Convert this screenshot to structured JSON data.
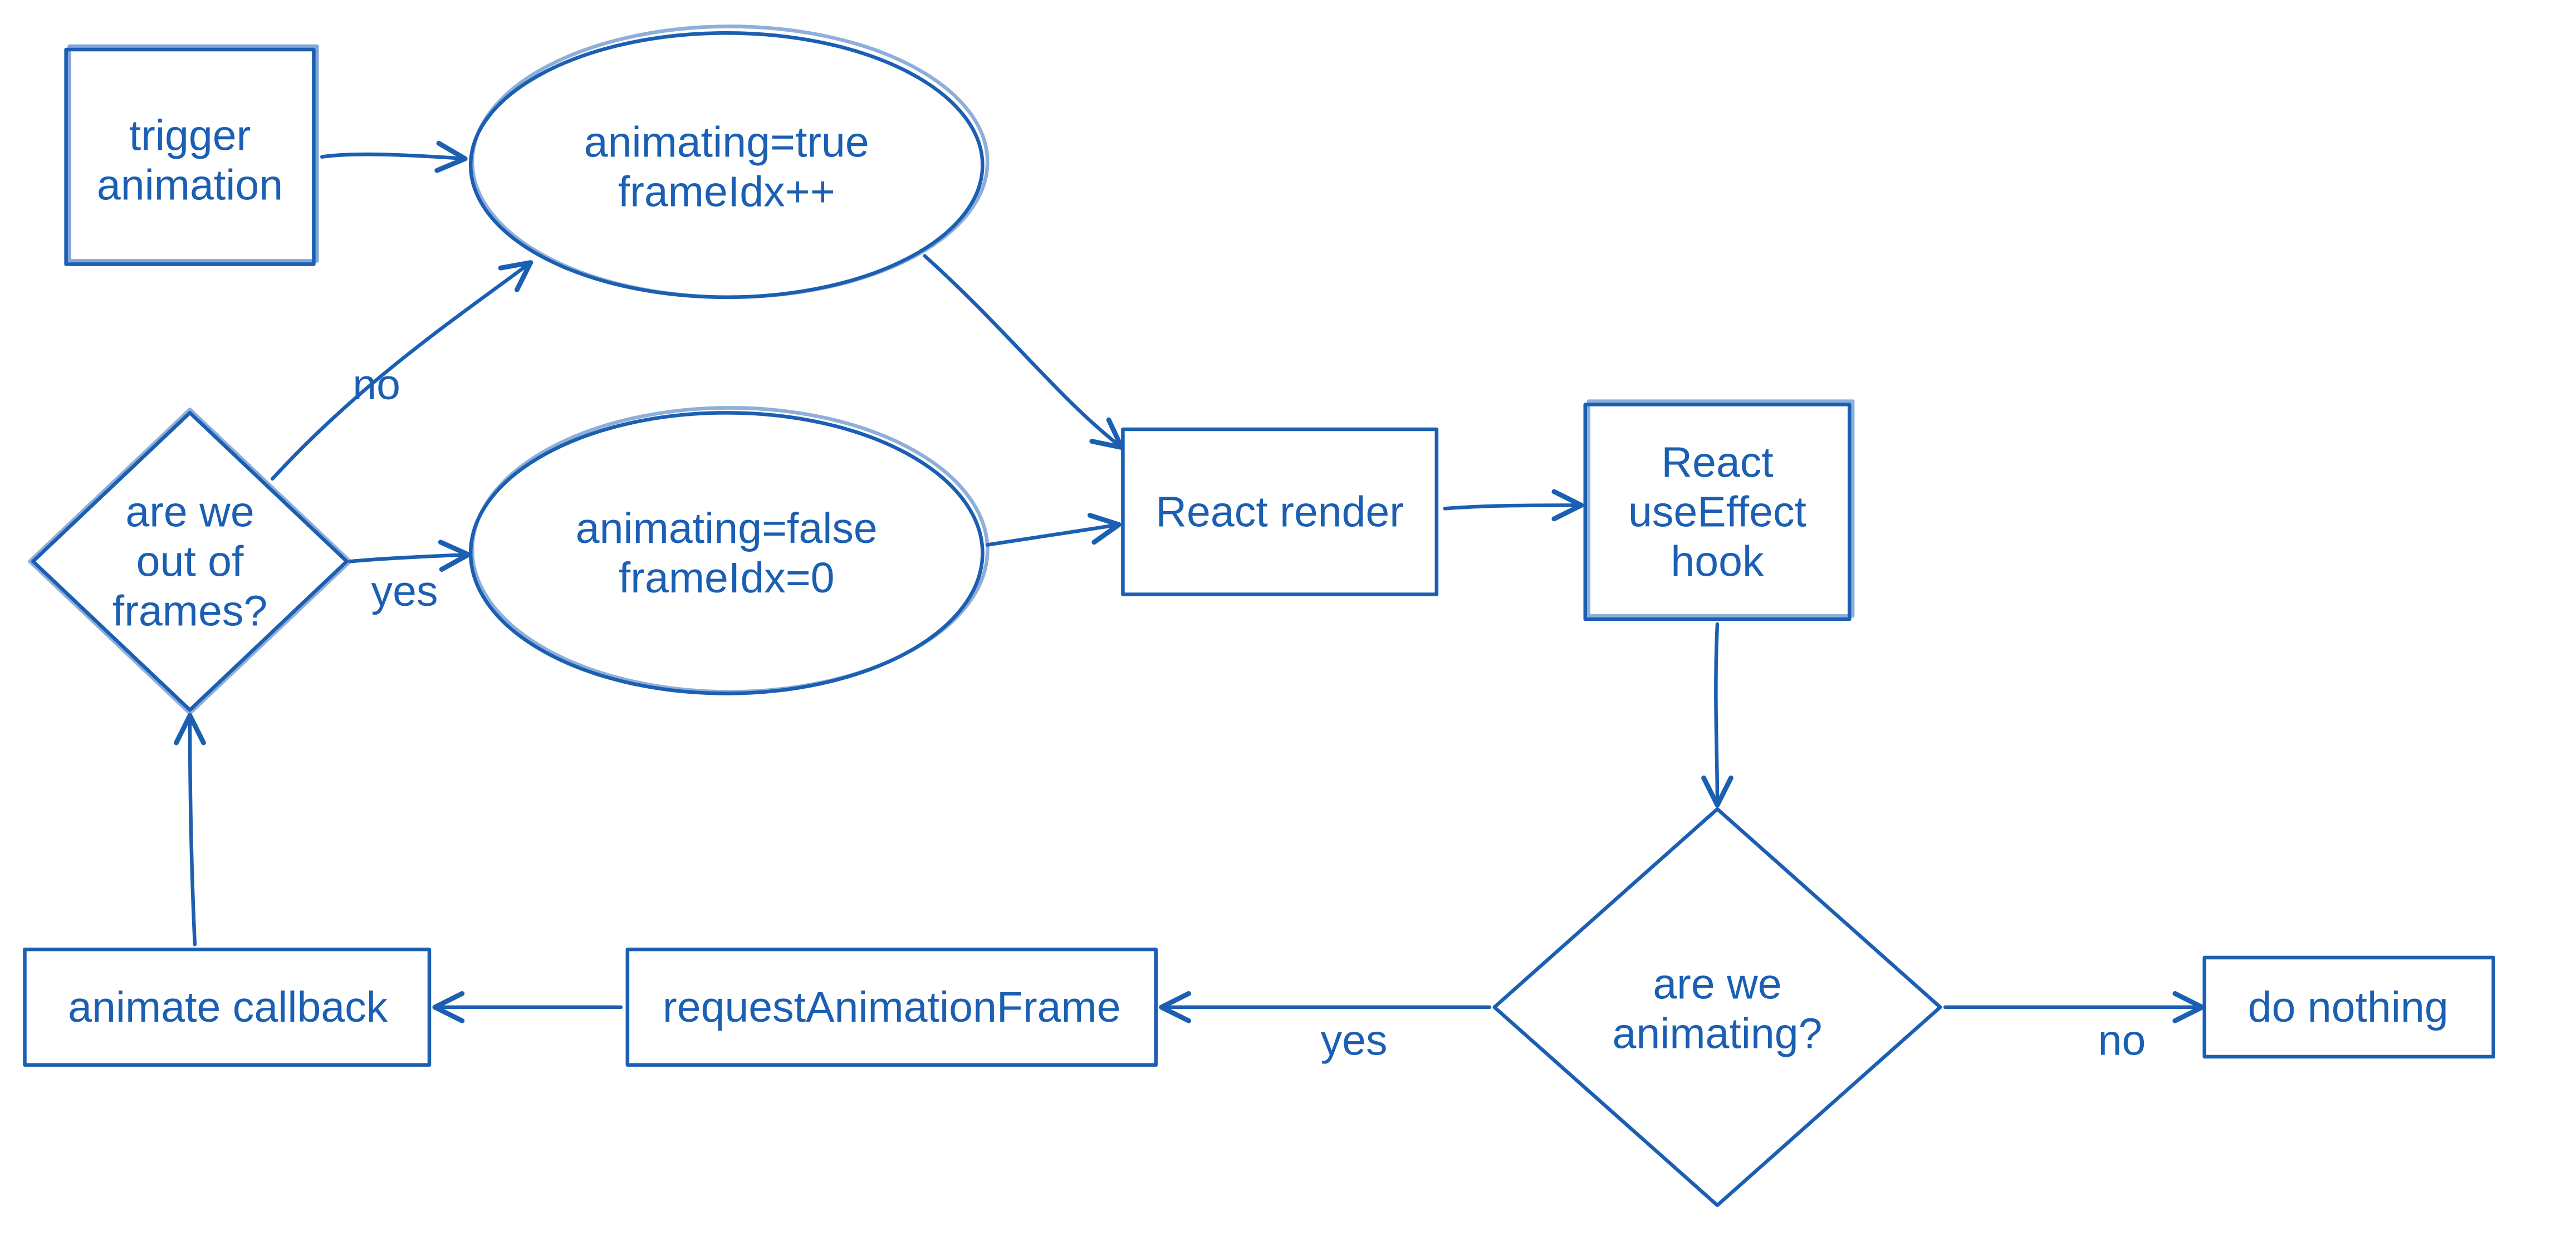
{
  "nodes": {
    "trigger": {
      "line1": "trigger",
      "line2": "animation"
    },
    "state_true": {
      "line1": "animating=true",
      "line2": "frameIdx++"
    },
    "state_false": {
      "line1": "animating=false",
      "line2": "frameIdx=0"
    },
    "out_of_frames": {
      "line1": "are we",
      "line2": "out of",
      "line3": "frames?"
    },
    "react_render": {
      "line1": "React render"
    },
    "use_effect": {
      "line1": "React",
      "line2": "useEffect",
      "line3": "hook"
    },
    "are_animating": {
      "line1": "are we",
      "line2": "animating?"
    },
    "raf": {
      "line1": "requestAnimationFrame"
    },
    "animate_cb": {
      "line1": "animate callback"
    },
    "do_nothing": {
      "line1": "do nothing"
    }
  },
  "edges": {
    "no1": "no",
    "yes1": "yes",
    "yes2": "yes",
    "no2": "no"
  }
}
